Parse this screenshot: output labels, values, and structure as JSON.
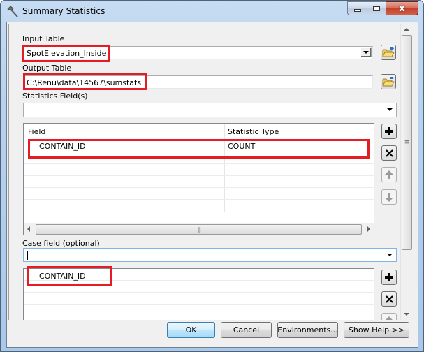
{
  "window": {
    "title": "Summary Statistics",
    "icon": "hammer-icon",
    "controls": {
      "minimize": "minimize",
      "maximize": "maximize",
      "close": "x"
    }
  },
  "form": {
    "input_table": {
      "label": "Input Table",
      "value": "SpotElevation_Inside"
    },
    "output_table": {
      "label": "Output Table",
      "value": "C:\\Renu\\data\\14567\\sumstats"
    },
    "statistics_fields": {
      "label": "Statistics Field(s)",
      "value": "",
      "columns": [
        "Field",
        "Statistic Type"
      ],
      "rows": [
        {
          "field": "CONTAIN_ID",
          "statistic_type": "COUNT"
        }
      ],
      "buttons": {
        "add": "+",
        "remove": "×",
        "up": "up",
        "down": "down"
      }
    },
    "case_field": {
      "label": "Case field (optional)",
      "value": "",
      "rows": [
        "CONTAIN_ID"
      ]
    }
  },
  "footer": {
    "ok": "OK",
    "cancel": "Cancel",
    "environments": "Environments...",
    "show_help": "Show Help >>"
  },
  "colors": {
    "highlight": "#e41c24",
    "title_bar": "#b7d2ee",
    "close_button": "#c2402a",
    "dialog_bg": "#f0f0f0"
  }
}
